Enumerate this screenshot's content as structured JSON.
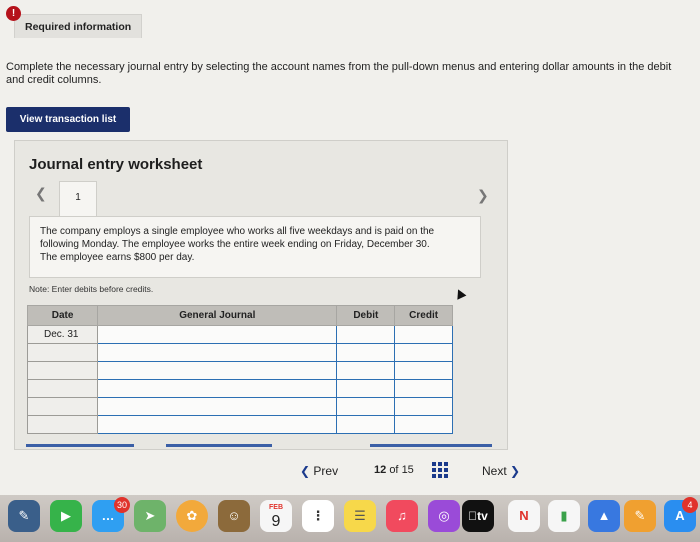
{
  "header": {
    "tab_label": "Required information",
    "alert_glyph": "!"
  },
  "instructions": "Complete the necessary journal entry by selecting the account names from the pull-down menus and entering dollar amounts in the debit and credit columns.",
  "view_button_label": "View transaction list",
  "worksheet": {
    "title": "Journal entry worksheet",
    "tab_number": "1",
    "description": "The company employs a single employee who works all five weekdays and is paid on the following Monday. The employee works the entire week ending on Friday, December 30. The employee earns $800 per day.",
    "note": "Note: Enter debits before credits.",
    "columns": [
      "Date",
      "General Journal",
      "Debit",
      "Credit"
    ],
    "rows": [
      {
        "date": "Dec. 31"
      },
      {
        "date": ""
      },
      {
        "date": ""
      },
      {
        "date": ""
      },
      {
        "date": ""
      },
      {
        "date": ""
      }
    ]
  },
  "pagination": {
    "prev_label": "Prev",
    "current": "12",
    "of_label": "of",
    "total": "15",
    "next_label": "Next"
  },
  "dock": {
    "calendar_month": "FEB",
    "calendar_day": "9",
    "messages_badge": "30",
    "keynote_badge": "4",
    "tv_label": "tv"
  },
  "colors": {
    "accent": "#1b2f6b",
    "alert": "#b5121b",
    "input_border": "#2c6fb3"
  }
}
